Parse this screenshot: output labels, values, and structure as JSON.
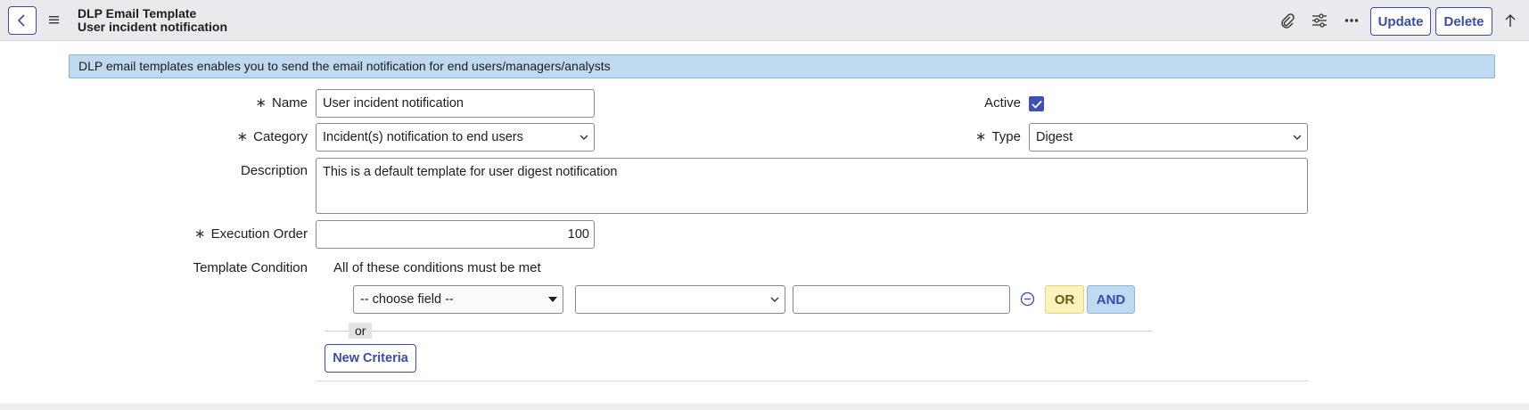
{
  "header": {
    "title": "DLP Email Template",
    "subtitle": "User incident notification",
    "icons": [
      "back-icon",
      "menu-icon",
      "paperclip-icon",
      "settings-sliders-icon",
      "more-icon",
      "arrow-up-icon"
    ],
    "update_label": "Update",
    "delete_label": "Delete"
  },
  "banner": {
    "text": "DLP email templates enables you to send the email notification for end users/managers/analysts"
  },
  "form": {
    "required_mark": "∗",
    "name_label": "Name",
    "name_value": "User incident notification",
    "active_label": "Active",
    "active_checked": true,
    "category_label": "Category",
    "category_value": "Incident(s) notification to end users",
    "type_label": "Type",
    "type_value": "Digest",
    "description_label": "Description",
    "description_value": "This is a default template for user digest notification",
    "execution_order_label": "Execution Order",
    "execution_order_value": "100",
    "template_condition_label": "Template Condition",
    "conditions_note": "All of these conditions must be met",
    "choose_field": "-- choose field --",
    "operator_value": "",
    "condition_value": "",
    "or_button": "OR",
    "and_button": "AND",
    "or_divider": "or",
    "new_criteria": "New Criteria"
  },
  "colors": {
    "accent": "#3c4aa8",
    "banner_bg": "#bfd9f0",
    "or_bg": "#fbf3bd"
  }
}
